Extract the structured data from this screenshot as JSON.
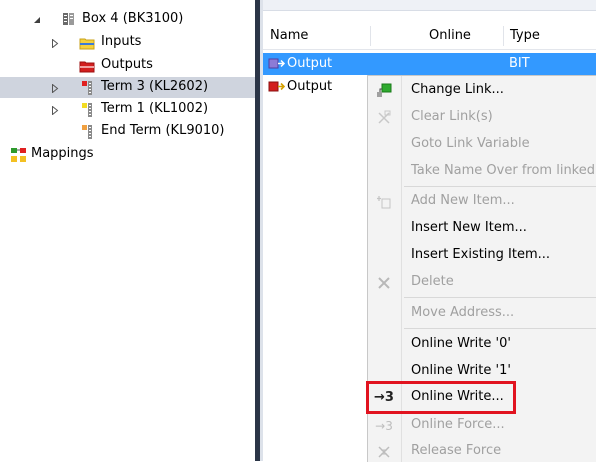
{
  "tree": {
    "box": {
      "label": "Box 4 (BK3100)",
      "icon": "box-coupler-icon"
    },
    "inputs": {
      "label": "Inputs",
      "icon": "inputs-folder-icon"
    },
    "outputs": {
      "label": "Outputs",
      "icon": "outputs-folder-icon"
    },
    "term3": {
      "label": "Term 3 (KL2602)",
      "icon": "terminal-red-icon"
    },
    "term1": {
      "label": "Term 1 (KL1002)",
      "icon": "terminal-yellow-icon"
    },
    "endterm": {
      "label": "End Term (KL9010)",
      "icon": "terminal-end-icon"
    },
    "mappings": {
      "label": "Mappings",
      "icon": "mappings-icon"
    }
  },
  "listview": {
    "columns": [
      "Name",
      "Online",
      "Type"
    ],
    "rows": [
      {
        "name": "Output",
        "online": "",
        "type": "BIT",
        "icon": "variable-output-icon",
        "selected": true
      },
      {
        "name": "Output",
        "online": "",
        "type": "",
        "icon": "variable-output-linked-icon",
        "selected": false
      }
    ]
  },
  "menu": {
    "items": [
      {
        "label": "Change Link...",
        "icon": "change-link-icon",
        "enabled": true
      },
      {
        "label": "Clear Link(s)",
        "icon": "clear-link-icon",
        "enabled": false
      },
      {
        "label": "Goto Link Variable",
        "icon": "",
        "enabled": false
      },
      {
        "label": "Take Name Over from linked",
        "icon": "",
        "enabled": false
      },
      {
        "label": "Add New Item...",
        "icon": "add-item-icon",
        "enabled": false
      },
      {
        "label": "Insert New Item...",
        "icon": "",
        "enabled": true
      },
      {
        "label": "Insert Existing Item...",
        "icon": "",
        "enabled": true
      },
      {
        "label": "Delete",
        "icon": "delete-x-icon",
        "enabled": false
      },
      {
        "label": "Move Address...",
        "icon": "",
        "enabled": false
      },
      {
        "label": "Online Write '0'",
        "icon": "",
        "enabled": true
      },
      {
        "label": "Online Write '1'",
        "icon": "",
        "enabled": true
      },
      {
        "label": "Online Write...",
        "icon": "online-write-icon",
        "icon_text": "→3",
        "enabled": true
      },
      {
        "label": "Online Force...",
        "icon": "online-force-icon",
        "icon_text": "→3",
        "enabled": false
      },
      {
        "label": "Release Force",
        "icon": "release-force-icon",
        "enabled": false
      }
    ]
  },
  "colors": {
    "selection_blue": "#3399ff",
    "tree_selection": "#cfd4de",
    "highlight_red": "#e1131f",
    "splitter": "#2b3547"
  }
}
